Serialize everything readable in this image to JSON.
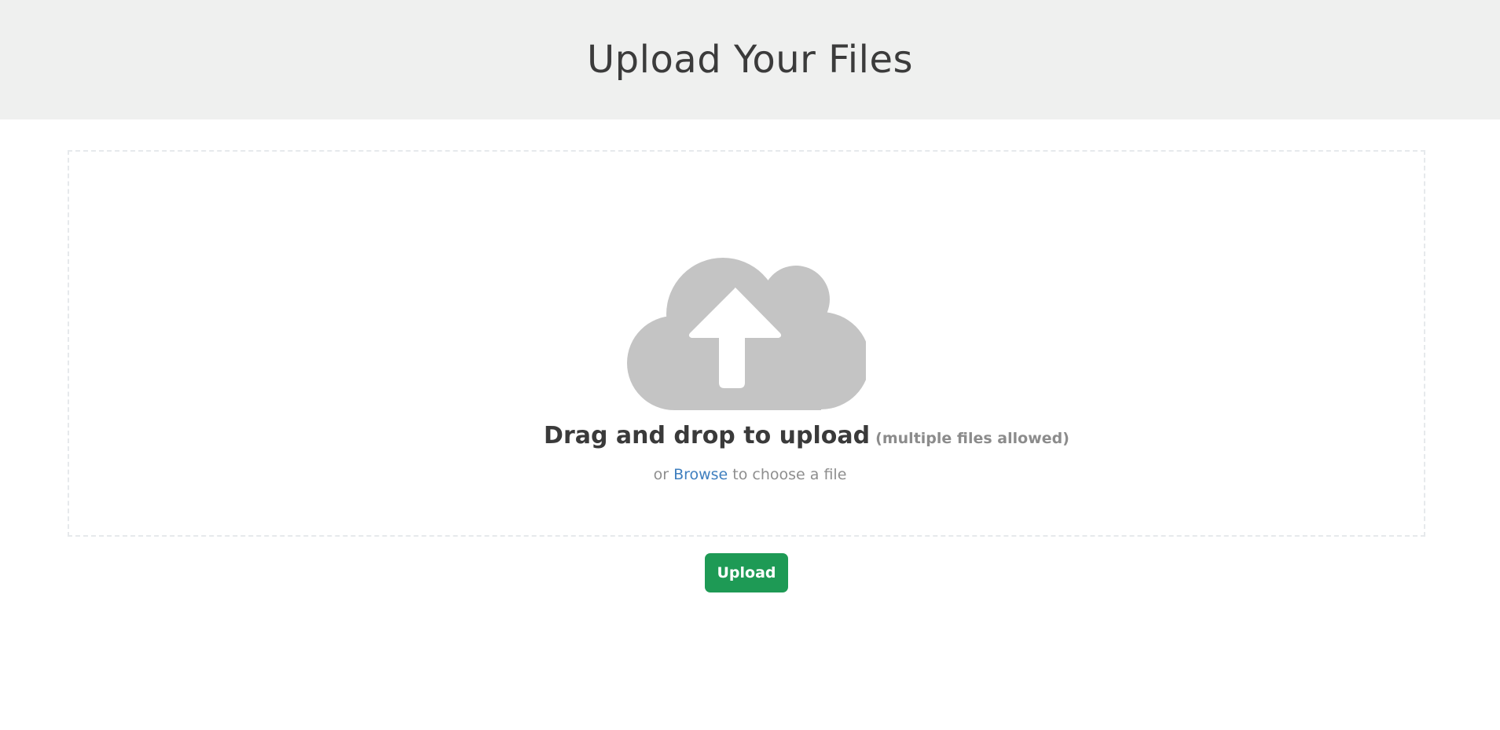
{
  "header": {
    "title": "Upload Your Files",
    "background": "#eff0ef"
  },
  "dropzone": {
    "icon": "cloud-upload-icon",
    "icon_color": "#c4c4c4",
    "title": "Drag and drop to upload",
    "hint": "(multiple files allowed)",
    "browse_prefix": "or",
    "browse_link": "Browse",
    "browse_suffix": "to choose a file",
    "link_color": "#3f7fbf"
  },
  "actions": {
    "upload_label": "Upload",
    "upload_color": "#1e9a55"
  }
}
